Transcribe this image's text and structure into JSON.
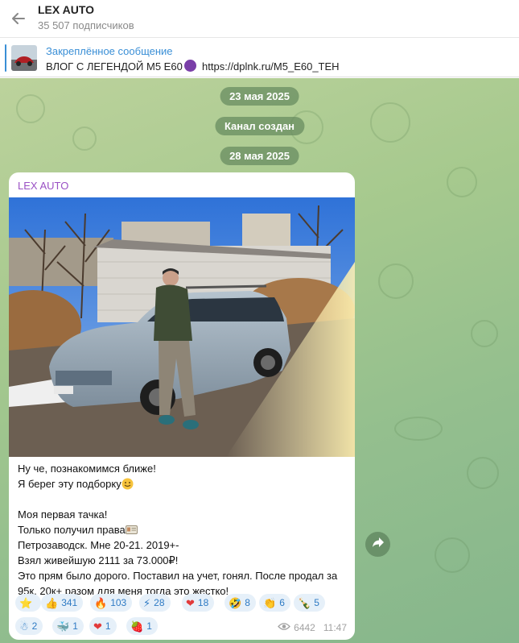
{
  "header": {
    "channel_name": "LEX AUTO",
    "subscribers": "35 507 подписчиков"
  },
  "pinned": {
    "title": "Закреплённое сообщение",
    "text": "ВЛОГ С ЛЕГЕНДОЙ М5 Е60",
    "link": "https://dplnk.ru/M5_E60_TEH"
  },
  "dates": {
    "first": "23 мая 2025",
    "channel_created": "Канал создан",
    "second": "28 мая 2025"
  },
  "message": {
    "author": "LEX AUTO",
    "lines": [
      "Ну че, познакомимся ближе!",
      "Я берег эту подборку",
      "",
      "Моя первая тачка!",
      "Только получил права",
      "Петрозаводск. Мне 20-21. 2019+-",
      "Взял живейшую 2111 за 73.000₽!",
      "Это прям было дорого. Поставил на учет, гонял. После продал за",
      "95к. 20к+ разом для меня тогда это жестко!"
    ],
    "views": "6442",
    "time": "11:47"
  },
  "reactions": [
    {
      "icon": "⭐",
      "count": ""
    },
    {
      "icon": "👍",
      "count": "341"
    },
    {
      "icon": "🔥",
      "count": "103"
    },
    {
      "icon": "⚡",
      "count": "28"
    },
    {
      "icon": "❤",
      "count": "18"
    },
    {
      "icon": "🤣",
      "count": "8"
    },
    {
      "icon": "👏",
      "count": "6"
    },
    {
      "icon": "🍾",
      "count": "5"
    },
    {
      "icon": "☃",
      "count": "2"
    },
    {
      "icon": "🐳",
      "count": "1"
    },
    {
      "icon": "❤",
      "count": "1"
    },
    {
      "icon": "🍓",
      "count": "1"
    }
  ],
  "colors": {
    "accent": "#3a8fd6",
    "author": "#9a51c4",
    "reaction_bg": "#e6f0f9"
  }
}
